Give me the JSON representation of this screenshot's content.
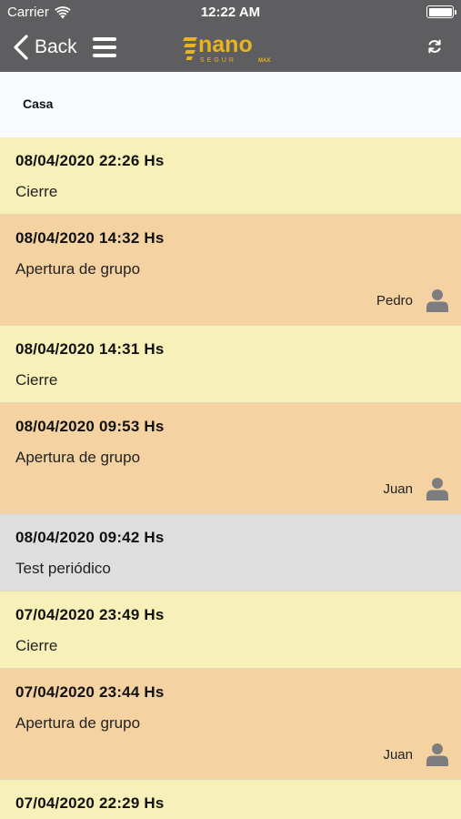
{
  "status_bar": {
    "carrier": "Carrier",
    "time": "12:22 AM"
  },
  "nav": {
    "back_label": "Back",
    "logo_text": "nano",
    "logo_sub": "SEGUR",
    "logo_badge": "MAX"
  },
  "section": {
    "title": "Casa"
  },
  "colors": {
    "cierre": "#f7f0b8",
    "apertura": "#f5d2a2",
    "test": "#dedede",
    "topbar": "#5e5e60",
    "brand": "#e8b420"
  },
  "events": [
    {
      "timestamp": "08/04/2020 22:26 Hs",
      "description": "Cierre",
      "type": "cierre"
    },
    {
      "timestamp": "08/04/2020 14:32 Hs",
      "description": "Apertura de grupo",
      "type": "apertura",
      "user": "Pedro"
    },
    {
      "timestamp": "08/04/2020 14:31 Hs",
      "description": "Cierre",
      "type": "cierre"
    },
    {
      "timestamp": "08/04/2020 09:53 Hs",
      "description": "Apertura de grupo",
      "type": "apertura",
      "user": "Juan"
    },
    {
      "timestamp": "08/04/2020 09:42 Hs",
      "description": "Test periódico",
      "type": "test"
    },
    {
      "timestamp": "07/04/2020 23:49 Hs",
      "description": "Cierre",
      "type": "cierre"
    },
    {
      "timestamp": "07/04/2020 23:44 Hs",
      "description": "Apertura de grupo",
      "type": "apertura",
      "user": "Juan"
    },
    {
      "timestamp": "07/04/2020 22:29 Hs",
      "description": "",
      "type": "cierre"
    }
  ]
}
